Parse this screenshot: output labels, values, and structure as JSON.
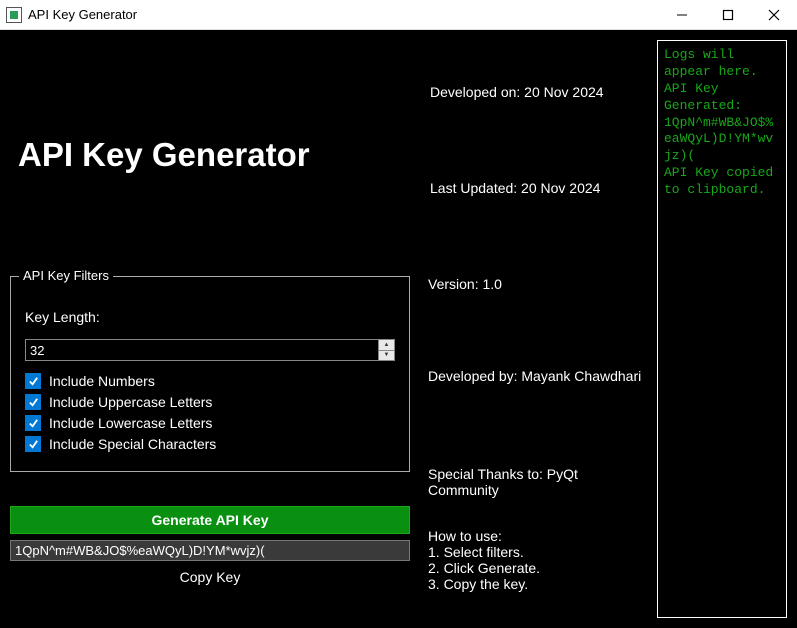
{
  "window": {
    "title": "API Key Generator"
  },
  "header": {
    "title": "API Key Generator"
  },
  "meta": {
    "developed_on": "Developed on: 20 Nov 2024",
    "last_updated": "Last Updated: 20 Nov 2024",
    "version": "Version: 1.0",
    "developed_by": "Developed by: Mayank Chawdhari",
    "thanks": "Special Thanks to: PyQt Community"
  },
  "filters": {
    "legend": "API Key Filters",
    "key_length_label": "Key Length:",
    "key_length_value": "32",
    "include_numbers": "Include Numbers",
    "include_uppercase": "Include Uppercase Letters",
    "include_lowercase": "Include Lowercase Letters",
    "include_special": "Include Special Characters"
  },
  "actions": {
    "generate": "Generate API Key",
    "output": "1QpN^m#WB&JO$%eaWQyL)D!YM*wvjz)(",
    "copy": "Copy Key"
  },
  "howto": {
    "title": "How to use:",
    "step1": "1. Select filters.",
    "step2": "2. Click Generate.",
    "step3": "3. Copy the key."
  },
  "logs": {
    "line1": "Logs will appear here.",
    "line2": "API Key Generated: 1QpN^m#WB&JO$%eaWQyL)D!YM*wvjz)(",
    "line3": "API Key copied to clipboard."
  }
}
